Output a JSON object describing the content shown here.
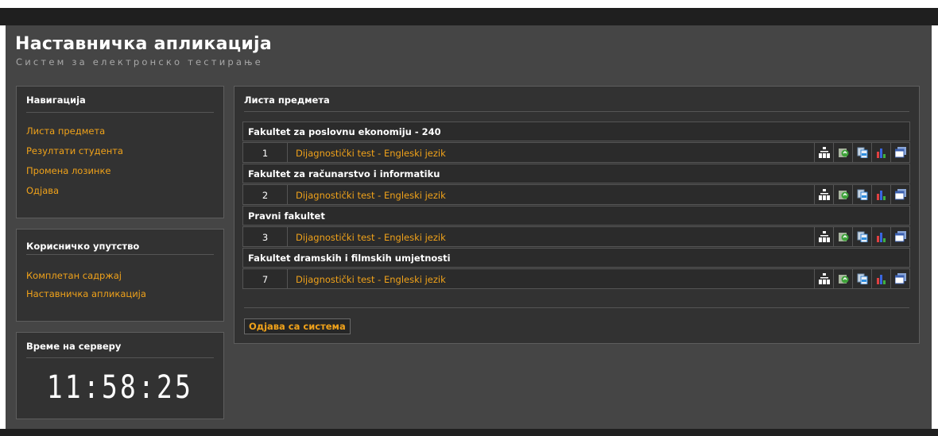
{
  "header": {
    "title": "Наставничка апликација",
    "subtitle": "Систем за електронско тестирање"
  },
  "sidebar": {
    "navigation": {
      "title": "Навигација",
      "items": [
        {
          "label": "Листа предмета"
        },
        {
          "label": "Резултати студента"
        },
        {
          "label": "Промена лозинке"
        },
        {
          "label": "Одјава"
        }
      ]
    },
    "manual": {
      "title": "Корисничко упутство",
      "items": [
        {
          "label": "Комплетан садржај"
        },
        {
          "label": "Наставничка апликација"
        }
      ]
    },
    "server_time": {
      "title": "Време на серверу",
      "clock": "11:58:25"
    }
  },
  "main": {
    "title": "Листа предмета",
    "groups": [
      {
        "name": "Fakultet za poslovnu ekonomiju - 240",
        "items": [
          {
            "num": "1",
            "label": "Dijagnostički test - Engleski jezik"
          }
        ]
      },
      {
        "name": "Fakultet za računarstvo i informatiku",
        "items": [
          {
            "num": "2",
            "label": "Dijagnostički test - Engleski jezik"
          }
        ]
      },
      {
        "name": "Pravni fakultet",
        "items": [
          {
            "num": "3",
            "label": "Dijagnostički test - Engleski jezik"
          }
        ]
      },
      {
        "name": "Fakultet dramskih i filmskih umjetnosti",
        "items": [
          {
            "num": "7",
            "label": "Dijagnostički test - Engleski jezik"
          }
        ]
      }
    ],
    "row_actions": [
      "hierarchy-icon",
      "refresh-icon",
      "copy-icon",
      "bar-chart-icon",
      "window-icon"
    ],
    "logout_label": "Одјава са система"
  },
  "colors": {
    "accent": "#f0a21a",
    "background": "#454545",
    "panel": "#323232"
  }
}
